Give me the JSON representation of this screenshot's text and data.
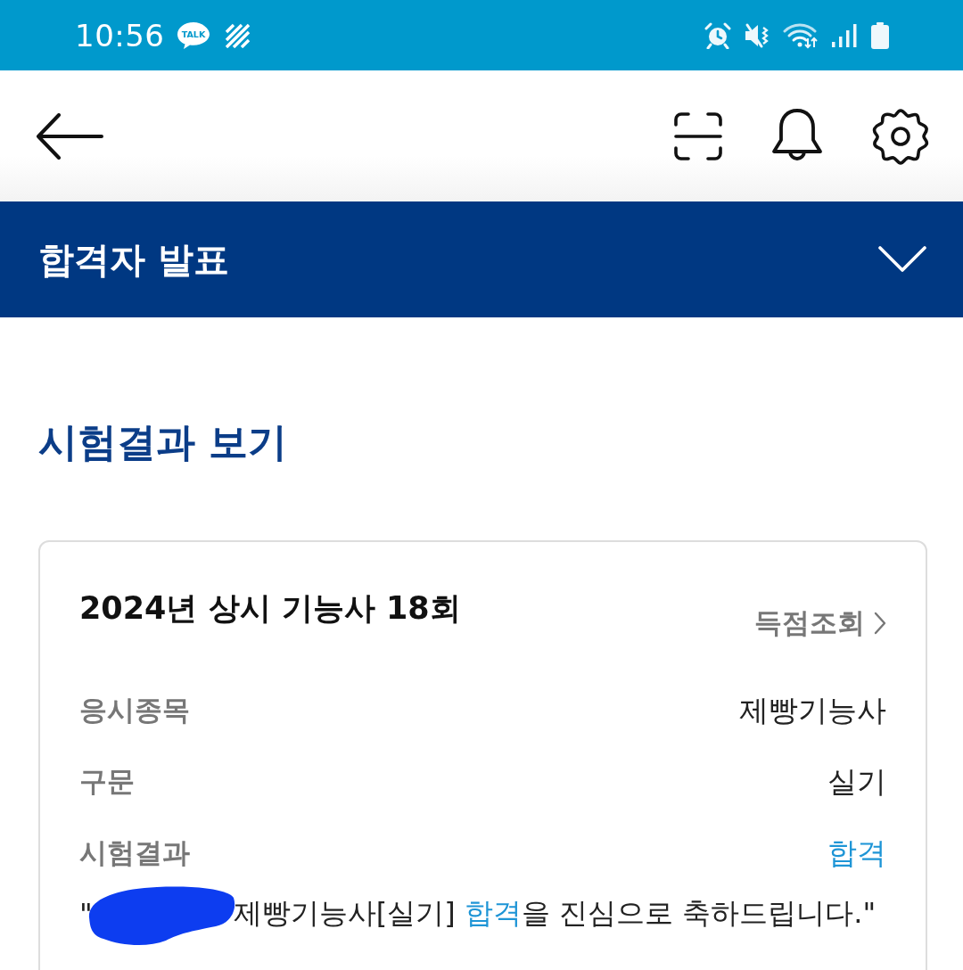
{
  "status_bar": {
    "time": "10:56",
    "chat_badge": "TALK"
  },
  "banner": {
    "title": "합격자 발표",
    "expanded": false
  },
  "page_title": "시험결과 보기",
  "result_card": {
    "exam": "2024년 상시 기능사 18회",
    "score_link": "득점조회",
    "rows": [
      {
        "label": "응시종목",
        "value": "제빵기능사",
        "kind": "plain"
      },
      {
        "label": "구문",
        "value": "실기",
        "kind": "plain"
      },
      {
        "label": "시험결과",
        "value": "합격",
        "kind": "highlight"
      }
    ],
    "message": {
      "opening_quote": "\"",
      "redacted": true,
      "parts": [
        {
          "text": "제빵기능사[실기] ",
          "highlight": false
        },
        {
          "text": "합격",
          "highlight": true
        },
        {
          "text": "을 진심으로 축하드립니다.\"",
          "highlight": false
        }
      ]
    }
  }
}
